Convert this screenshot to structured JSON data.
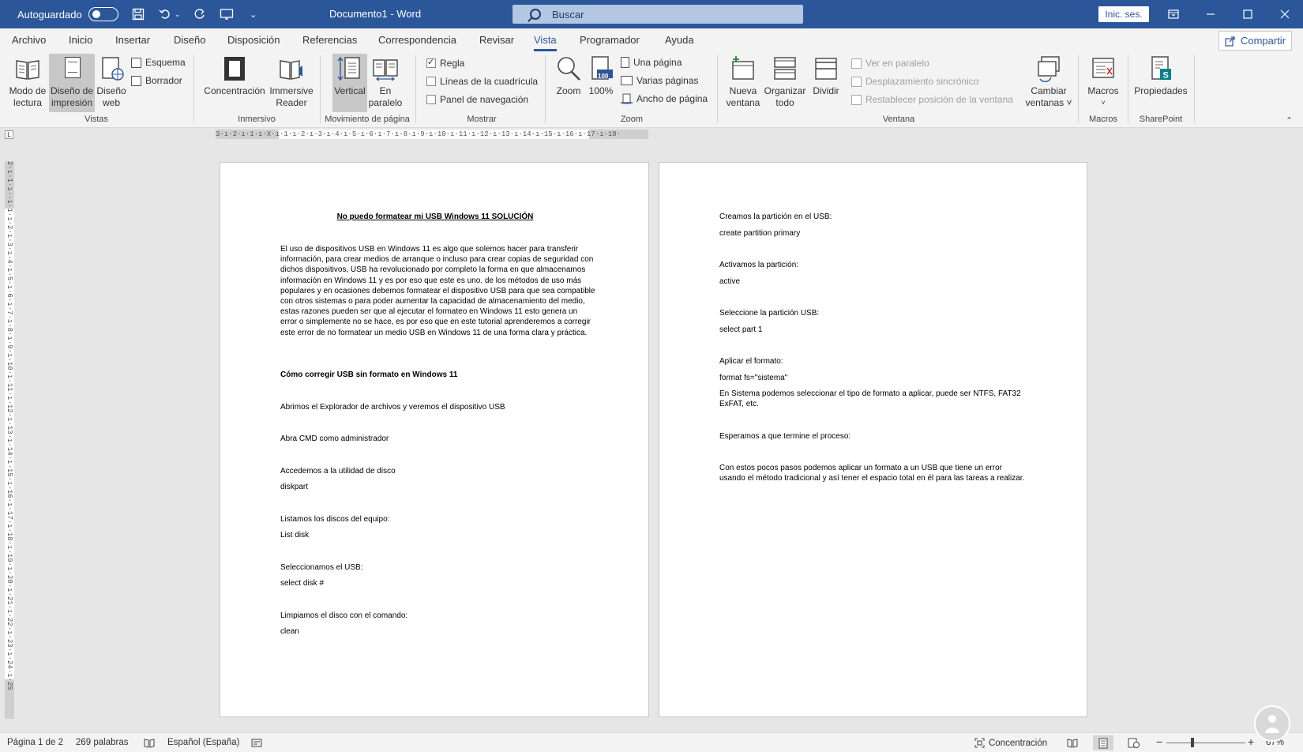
{
  "titlebar": {
    "autosave_label": "Autoguardado",
    "doc_title": "Documento1 - Word",
    "search_placeholder": "Buscar",
    "signin_label": "Inic. ses.",
    "colors": {
      "titlebar_bg": "#2b579a",
      "accent": "#2b579a"
    }
  },
  "tabs": [
    "Archivo",
    "Inicio",
    "Insertar",
    "Diseño",
    "Disposición",
    "Referencias",
    "Correspondencia",
    "Revisar",
    "Vista",
    "Programador",
    "Ayuda"
  ],
  "active_tab": "Vista",
  "share_label": "Compartir",
  "ribbon": {
    "vistas": {
      "label": "Vistas",
      "read_mode": [
        "Modo de",
        "lectura"
      ],
      "print_layout": [
        "Diseño de",
        "impresión"
      ],
      "web_layout": [
        "Diseño",
        "web"
      ],
      "outline": "Esquema",
      "draft": "Borrador"
    },
    "inmersivo": {
      "label": "Inmersivo",
      "focus": "Concentración",
      "immersive_reader": [
        "Immersive",
        "Reader"
      ]
    },
    "movimiento": {
      "label": "Movimiento de página",
      "vertical": "Vertical",
      "side_by_side": [
        "En",
        "paralelo"
      ]
    },
    "mostrar": {
      "label": "Mostrar",
      "ruler": "Regla",
      "gridlines": "Líneas de la cuadrícula",
      "nav_pane": "Panel de navegación"
    },
    "zoom": {
      "label": "Zoom",
      "zoom": "Zoom",
      "hundred": "100%",
      "hundred_badge": "100",
      "one_page": "Una página",
      "multiple_pages": "Varias páginas",
      "page_width": "Ancho de página"
    },
    "ventana": {
      "label": "Ventana",
      "new_window": [
        "Nueva",
        "ventana"
      ],
      "arrange_all": [
        "Organizar",
        "todo"
      ],
      "split": "Dividir",
      "view_side": "Ver en paralelo",
      "sync_scroll": "Desplazamiento sincrónico",
      "reset_pos": "Restablecer posición de la ventana",
      "switch_windows": [
        "Cambiar",
        "ventanas ˅"
      ]
    },
    "macros": {
      "label": "Macros",
      "button": "Macros"
    },
    "sharepoint": {
      "label": "SharePoint",
      "button": "Propiedades"
    }
  },
  "ruler_h": "3·ı·2·ı·1·ı·X·ı·1·ı·2·ı·3·ı·4·ı·5·ı·6·ı·7·ı·8·ı·9·ı·10·ı·11·ı·12·ı·13·ı·14·ı·15·ı·16·ı·17·ı·18·",
  "ruler_v": "2·ı·1·ı··ı·1·ı·2·ı·3·ı·4·ı·5·ı·6·ı·7·ı·8·ı·9·ı·10·ı·11·ı·12·ı·13·ı·14·ı·15·ı·16·ı·17·ı·18·ı·19·ı·20·ı·21·ı·22·ı·23·ı·24·ı·25",
  "page1": {
    "title": "No puedo formatear mi USB Windows 11 SOLUCIÓN",
    "intro": "El uso de dispositivos USB en Windows 11 es algo que solemos hacer para transferir información, para crear medios de arranque o incluso para crear copias de seguridad con dichos dispositivos, USB ha revolucionado por completo la forma en que almacenamos información en Windows 11 y es por eso que este es uno. de los métodos de uso más populares y en ocasiones debemos formatear el dispositivo USB para que sea compatible con otros sistemas o para poder aumentar la capacidad de almacenamiento del medio, estas razones pueden ser que al ejecutar el formateo en Windows 11 esto genera un error o simplemente no se hace, es por eso que en este tutorial aprenderemos a corregir este error de no formatear un medio USB en Windows 11 de una forma clara y práctica.",
    "heading": "Cómo corregir USB sin formato en Windows 11",
    "step1": "Abrimos el Explorador de archivos y veremos el dispositivo USB",
    "step2": "Abra CMD como administrador",
    "step3": "Accedemos a la utilidad de disco",
    "cmd3": "diskpart",
    "step4": "Listamos los discos del equipo:",
    "cmd4": "List disk",
    "step5": "Seleccionamos el USB:",
    "cmd5": "select disk #",
    "step6": "Limpiamos el disco con el comando:",
    "cmd6": "clean"
  },
  "page2": {
    "step1": "Creamos la partición en el USB:",
    "cmd1": "create partition primary",
    "step2": "Activamos la partición:",
    "cmd2": "active",
    "step3": "Seleccione la partición USB:",
    "cmd3": "select part 1",
    "step4": "Aplicar el formato:",
    "cmd4": "format fs=\"sistema\"",
    "note4": "En Sistema podemos seleccionar el tipo de formato a aplicar, puede ser NTFS, FAT32 ExFAT, etc.",
    "step5": "Esperamos a que termine el proceso:",
    "closing": "Con estos pocos pasos podemos aplicar un formato a un USB que tiene un error usando el método tradicional y así tener el espacio total en él para las tareas a realizar."
  },
  "statusbar": {
    "page": "Página 1 de 2",
    "words": "269 palabras",
    "language": "Español (España)",
    "focus": "Concentración",
    "zoom_minus": "−",
    "zoom_plus": "+",
    "zoom_level": "67%"
  }
}
